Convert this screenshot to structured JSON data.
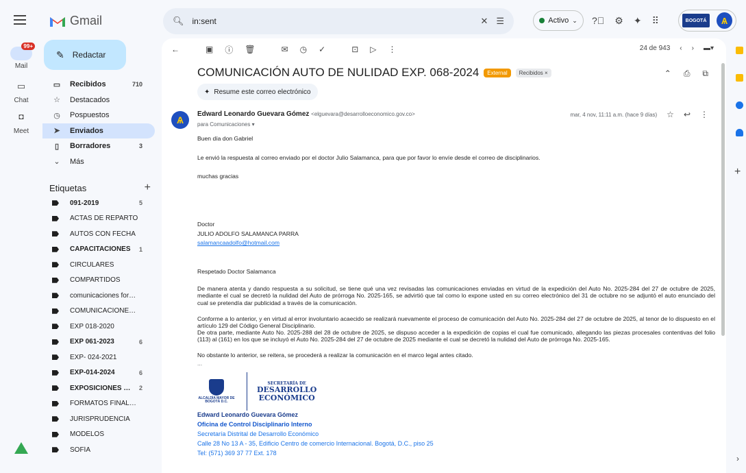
{
  "app": {
    "name": "Gmail"
  },
  "rail": [
    {
      "label": "Mail",
      "badge": "99+"
    },
    {
      "label": "Chat"
    },
    {
      "label": "Meet"
    }
  ],
  "compose_label": "Redactar",
  "nav": [
    {
      "label": "Recibidos",
      "count": "710",
      "icon": "inbox-icon",
      "glyph": "▭",
      "style": "bold"
    },
    {
      "label": "Destacados",
      "count": "",
      "icon": "star-icon",
      "glyph": "☆",
      "style": ""
    },
    {
      "label": "Pospuestos",
      "count": "",
      "icon": "clock-icon",
      "glyph": "◷",
      "style": ""
    },
    {
      "label": "Enviados",
      "count": "",
      "icon": "send-icon",
      "glyph": "➤",
      "style": "active"
    },
    {
      "label": "Borradores",
      "count": "3",
      "icon": "draft-icon",
      "glyph": "▯",
      "style": "bold"
    },
    {
      "label": "Más",
      "count": "",
      "icon": "chevron-down-icon",
      "glyph": "⌄",
      "style": ""
    }
  ],
  "labels_title": "Etiquetas",
  "labels": [
    {
      "label": "091-2019",
      "count": "5",
      "bold": true
    },
    {
      "label": "ACTAS DE REPARTO",
      "count": "",
      "bold": false
    },
    {
      "label": "AUTOS CON FECHA",
      "count": "",
      "bold": false
    },
    {
      "label": "CAPACITACIONES",
      "count": "1",
      "bold": true
    },
    {
      "label": "CIRCULARES",
      "count": "",
      "bold": false
    },
    {
      "label": "COMPARTIDOS",
      "count": "",
      "bold": false
    },
    {
      "label": "comunicaciones formato...",
      "count": "",
      "bold": false
    },
    {
      "label": "COMUNICACIONES Y/O ...",
      "count": "",
      "bold": false
    },
    {
      "label": "EXP 018-2020",
      "count": "",
      "bold": false
    },
    {
      "label": "EXP 061-2023",
      "count": "6",
      "bold": true
    },
    {
      "label": "EXP- 024-2021",
      "count": "",
      "bold": false
    },
    {
      "label": "EXP-014-2024",
      "count": "6",
      "bold": true
    },
    {
      "label": "EXPOSICIONES SE...",
      "count": "2",
      "bold": true
    },
    {
      "label": "FORMATOS FINALES PR...",
      "count": "",
      "bold": false
    },
    {
      "label": "JURISPRUDENCIA",
      "count": "",
      "bold": false
    },
    {
      "label": "MODELOS",
      "count": "",
      "bold": false
    },
    {
      "label": "SOFÍA",
      "count": "",
      "bold": false
    }
  ],
  "search": {
    "query": "in:sent"
  },
  "status": {
    "label": "Activo",
    "color": "#188038"
  },
  "account": {
    "brand": "BOGOTÁ"
  },
  "pager": {
    "text": "24 de 943"
  },
  "email": {
    "subject": "COMUNICACIÓN AUTO DE NULIDAD EXP. 068-2024",
    "chip_external": "External",
    "chip_inbox": "Recibidos ×",
    "summarize": "Resume este correo electrónico",
    "sender_name": "Edward Leonardo Guevara Gómez",
    "sender_email": "<elguevara@desarrolloeconomico.gov.co>",
    "to": "para Comunicaciones ▾",
    "date": "mar, 4 nov, 11:11 a.m. (hace 9 días)",
    "greeting": "Buen día don Gabriel",
    "p1": "Le envió la respuesta al correo enviado por el doctor Julio Salamanca, para que por favor lo envíe desde el correo de disciplinarios.",
    "thanks": "muchas gracias",
    "doctor": "Doctor",
    "doctor_name": "JULIO ADOLFO SALAMANCA PARRA",
    "doctor_email": "salamancaadolfo@hotmail.com",
    "respetado": "Respetado Doctor Salamanca",
    "p2": "De manera atenta y dando respuesta a su solicitud, se tiene qué una vez revisadas las comunicaciones enviadas en virtud de la expedición del Auto No. 2025-284 del 27 de octubre de 2025, mediante el cual se decretó la nulidad del Auto de prórroga No. 2025-165, se advirtió que tal como lo expone usted en su correo electrónico del 31 de octubre no se adjuntó el auto enunciado del cual se pretendía dar publicidad a través de la comunicación.",
    "p3": "Conforme a lo anterior, y en virtud al error involuntario acaecido se realizará nuevamente el proceso de comunicación del Auto No. 2025-284 del 27 de octubre de 2025, al tenor de lo dispuesto en el artículo 129 del Código General Disciplinario.",
    "p4": "De otra parte, mediante Auto No. 2025-288 del 28 de octubre de 2025, se dispuso acceder a la expedición de copias el cual fue comunicado, allegando las piezas procesales contentivas del folio (113) al (161) en los que se incluyó el Auto No. 2025-284 del 27 de octubre de 2025 mediante el cual se decretó la nulidad del Auto de prórroga No. 2025-165.",
    "p5": "No obstante lo anterior, se reitera, se procederá a realizar la comunicación en el marco legal antes citado.",
    "ellipsis": "...",
    "logo_alcaldia": "ALCALDÍA MAYOR DE BOGOTÁ D.C.",
    "logo_sec1": "SECRETARÍA DE",
    "logo_sec2": "DESARROLLO",
    "logo_sec3": "ECONÓMICO",
    "sig_name": "Edward Leonardo Guevara Gómez",
    "sig_office": "Oficina de Control Disciplinario Interno",
    "sig_entity": "Secretaría Distrital de Desarrollo Económico",
    "sig_address": "Calle 28 No 13 A - 35, Edificio Centro de comercio Internacional. Bogotá, D.C., piso 25",
    "sig_tel": "Tel: (571) 369 37 77 Ext. 178"
  }
}
